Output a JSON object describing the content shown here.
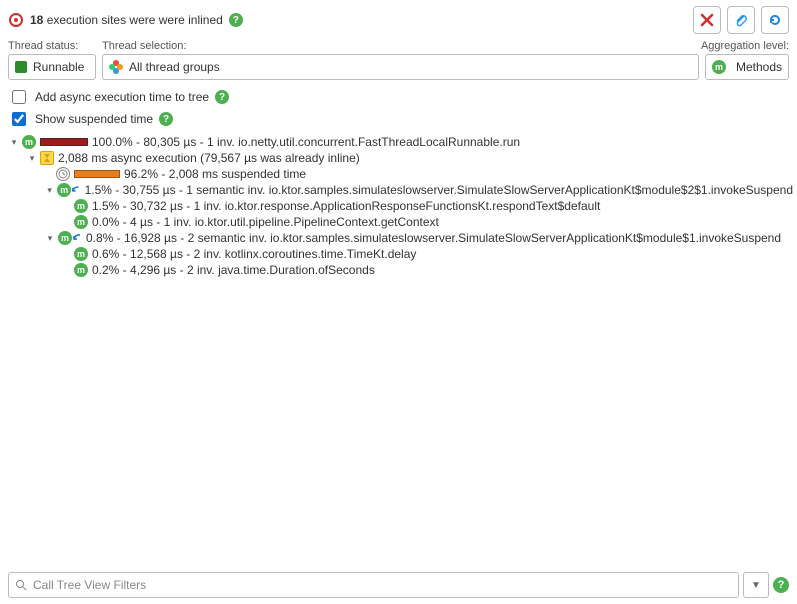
{
  "header": {
    "count": "18",
    "message": "execution sites were were inlined"
  },
  "labels": {
    "thread_status": "Thread status:",
    "thread_selection": "Thread selection:",
    "aggregation": "Aggregation level:"
  },
  "controls": {
    "status_value": "Runnable",
    "selection_value": "All thread groups",
    "aggregation_value": "Methods"
  },
  "checkboxes": {
    "async_label": "Add async execution time to tree",
    "suspended_label": "Show suspended time"
  },
  "filter": {
    "placeholder": "Call Tree View Filters"
  },
  "tree": {
    "n0": "100.0% - 80,305 µs - 1 inv. io.netty.util.concurrent.FastThreadLocalRunnable.run",
    "n1": "2,088 ms async execution (79,567 µs was already inline)",
    "n2": "96.2% - 2,008 ms suspended time",
    "n3": "1.5% - 30,755 µs - 1 semantic inv. io.ktor.samples.simulateslowserver.SimulateSlowServerApplicationKt$module$2$1.invokeSuspend",
    "n4": "1.5% - 30,732 µs - 1 inv. io.ktor.response.ApplicationResponseFunctionsKt.respondText$default",
    "n5": "0.0% - 4 µs - 1 inv. io.ktor.util.pipeline.PipelineContext.getContext",
    "n6": "0.8% - 16,928 µs - 2 semantic inv. io.ktor.samples.simulateslowserver.SimulateSlowServerApplicationKt$module$1.invokeSuspend",
    "n7": "0.6% - 12,568 µs - 2 inv. kotlinx.coroutines.time.TimeKt.delay",
    "n8": "0.2% - 4,296 µs - 2 inv. java.time.Duration.ofSeconds"
  }
}
